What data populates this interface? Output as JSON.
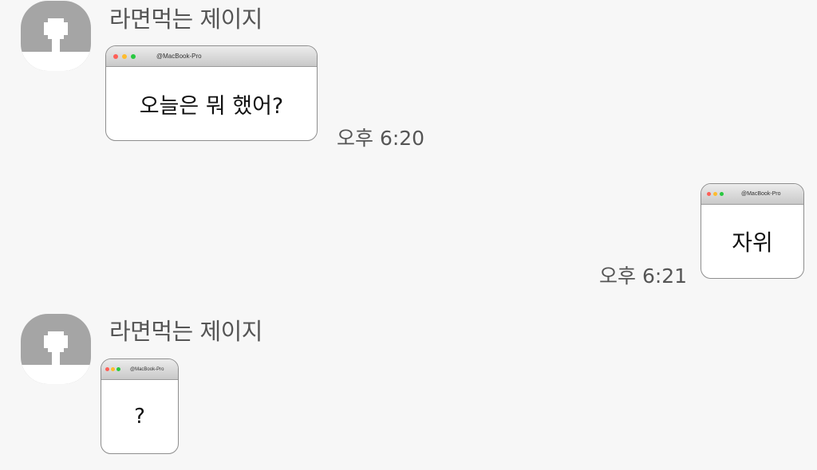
{
  "colors": {
    "background": "#f7f7f7",
    "avatar": "#a5a5a5",
    "bubble": "#ffffff",
    "traffic_red": "#fe5f57",
    "traffic_yellow": "#febc2e",
    "traffic_green": "#28c840"
  },
  "icons": {
    "avatar": "default-profile-silhouette",
    "window_controls": "macos-traffic-lights"
  },
  "messages": [
    {
      "direction": "incoming",
      "sender": "라면먹는 제이지",
      "window_title": "@MacBook-Pro",
      "text": "오늘은 뭐 했어?",
      "time": "오후 6:20"
    },
    {
      "direction": "outgoing",
      "window_title": "@MacBook-Pro",
      "text": "자위",
      "time": "오후 6:21"
    },
    {
      "direction": "incoming",
      "sender": "라면먹는 제이지",
      "window_title": "@MacBook-Pro",
      "text": "?"
    }
  ]
}
